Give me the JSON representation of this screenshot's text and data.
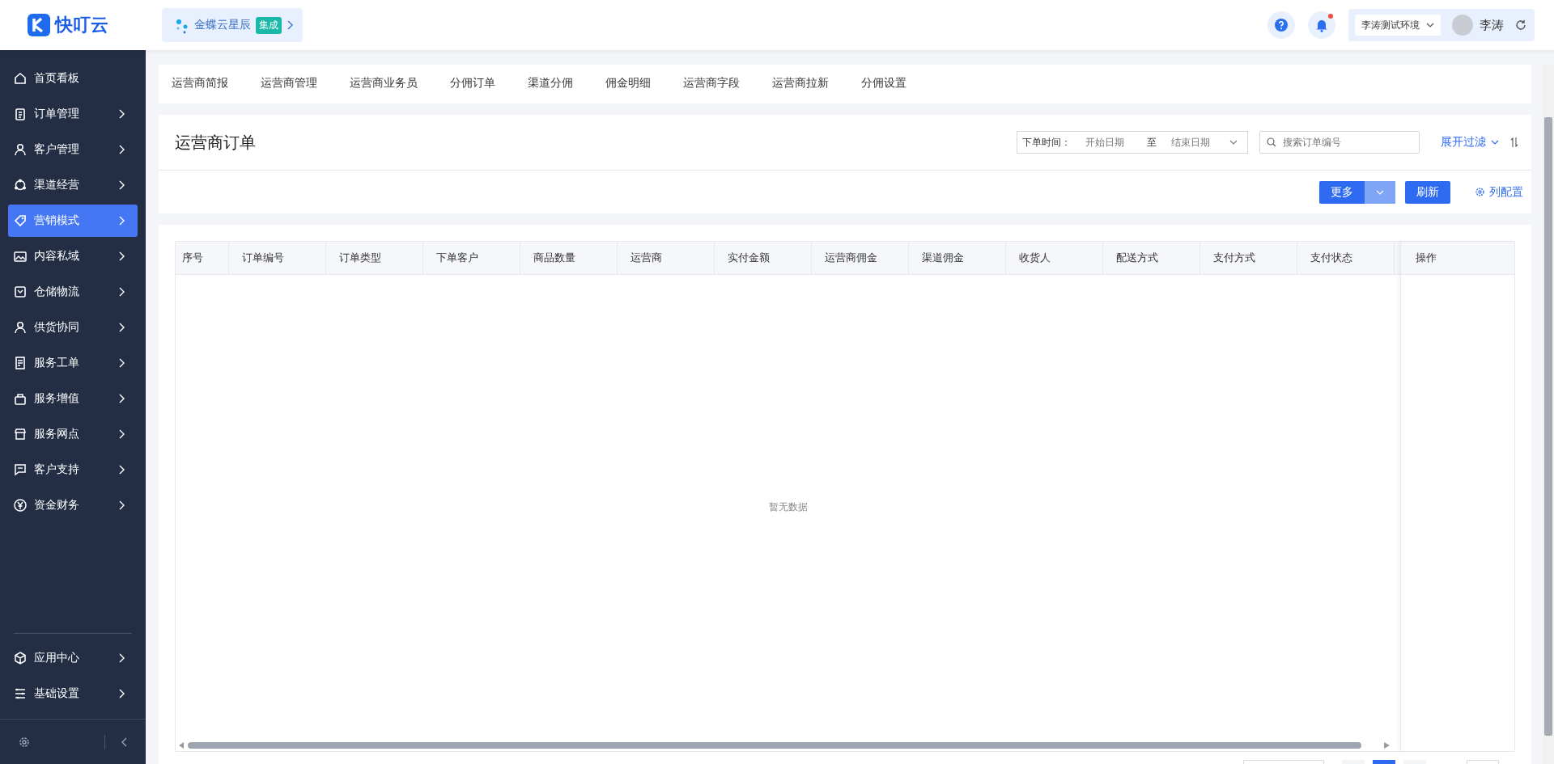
{
  "header": {
    "logo": "快叮云",
    "org": {
      "name": "金蝶云星辰",
      "badge": "集成"
    },
    "notification_dot": true,
    "environment": "李涛测试环境",
    "user": "李涛"
  },
  "sidebar": {
    "items": [
      {
        "label": "首页看板",
        "arrow": false,
        "selected": false
      },
      {
        "label": "订单管理",
        "arrow": true,
        "selected": false
      },
      {
        "label": "客户管理",
        "arrow": true,
        "selected": false
      },
      {
        "label": "渠道经营",
        "arrow": true,
        "selected": false
      },
      {
        "label": "营销模式",
        "arrow": true,
        "selected": true
      },
      {
        "label": "内容私域",
        "arrow": true,
        "selected": false
      },
      {
        "label": "仓储物流",
        "arrow": true,
        "selected": false
      },
      {
        "label": "供货协同",
        "arrow": true,
        "selected": false
      },
      {
        "label": "服务工单",
        "arrow": true,
        "selected": false
      },
      {
        "label": "服务增值",
        "arrow": true,
        "selected": false
      },
      {
        "label": "服务网点",
        "arrow": true,
        "selected": false
      },
      {
        "label": "客户支持",
        "arrow": true,
        "selected": false
      },
      {
        "label": "资金财务",
        "arrow": true,
        "selected": false
      }
    ],
    "bottom_items": [
      {
        "label": "应用中心",
        "arrow": true,
        "selected": false
      },
      {
        "label": "基础设置",
        "arrow": true,
        "selected": false
      }
    ]
  },
  "tabs": [
    {
      "label": "运营商简报",
      "selected": false
    },
    {
      "label": "运营商管理",
      "selected": false
    },
    {
      "label": "运营商业务员",
      "selected": false
    },
    {
      "label": "分佣订单",
      "selected": false
    },
    {
      "label": "渠道分佣",
      "selected": false
    },
    {
      "label": "佣金明细",
      "selected": false
    },
    {
      "label": "运营商字段",
      "selected": false
    },
    {
      "label": "运营商拉新",
      "selected": false
    },
    {
      "label": "分佣设置",
      "selected": false
    }
  ],
  "panel": {
    "title": "运营商订单",
    "date_filter": {
      "label": "下单时间：",
      "start_placeholder": "开始日期",
      "separator": "至",
      "end_placeholder": "结束日期"
    },
    "search": {
      "placeholder": "搜索订单编号"
    },
    "expand_filter": "展开过滤",
    "buttons": {
      "more": "更多",
      "refresh": "刷新",
      "columns": "列配置"
    }
  },
  "table": {
    "columns": [
      "序号",
      "订单编号",
      "订单类型",
      "下单客户",
      "商品数量",
      "运营商",
      "实付金额",
      "运营商佣金",
      "渠道佣金",
      "收货人",
      "配送方式",
      "支付方式",
      "支付状态"
    ],
    "fixed_column": "操作",
    "empty_text": "暂无数据"
  }
}
